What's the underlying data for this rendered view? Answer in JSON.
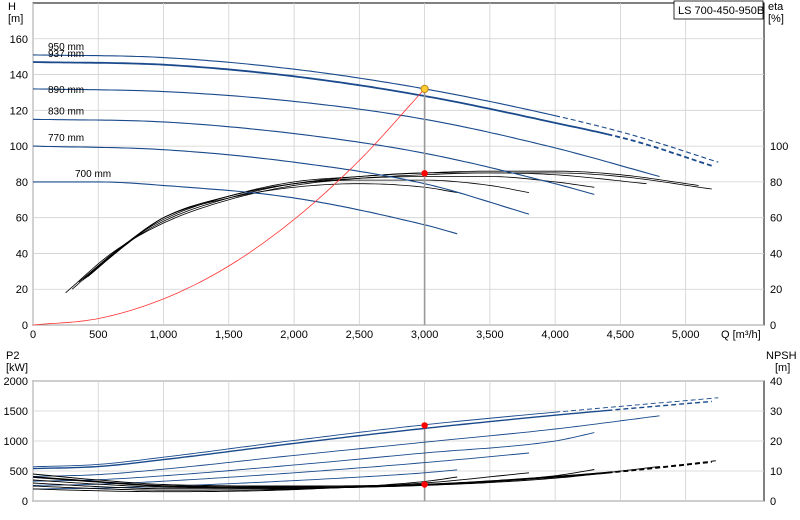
{
  "model": "LS 700-450-950B",
  "chart_data": [
    {
      "type": "line",
      "name": "head-efficiency",
      "xlabel": "Q [m³/h]",
      "ylabel_left": [
        "H",
        "[m]"
      ],
      "ylabel_right": [
        "eta",
        "[%]"
      ],
      "xlim": [
        0,
        5600
      ],
      "ylim_left": [
        0,
        180
      ],
      "ylim_right": [
        0,
        180
      ],
      "x_ticks": [
        "0",
        "500",
        "1,000",
        "1,500",
        "2,000",
        "2,500",
        "3,000",
        "3,500",
        "4,000",
        "4,500",
        "5,000"
      ],
      "x_tick_values": [
        0,
        500,
        1000,
        1500,
        2000,
        2500,
        3000,
        3500,
        4000,
        4500,
        5000
      ],
      "y_ticks_left": [
        "0",
        "20",
        "40",
        "60",
        "80",
        "100",
        "120",
        "140",
        "160"
      ],
      "y_tick_values_left": [
        0,
        20,
        40,
        60,
        80,
        100,
        120,
        140,
        160
      ],
      "y_ticks_right": [
        "0",
        "20",
        "40",
        "60",
        "80",
        "100"
      ],
      "y_tick_values_right": [
        0,
        20,
        40,
        60,
        80,
        100
      ],
      "grid": true,
      "head_curves": [
        {
          "label": "950 mm",
          "x": [
            0,
            1000,
            2000,
            3000,
            4000,
            4600,
            5250
          ],
          "y": [
            151,
            149.5,
            143,
            132,
            117,
            106,
            91
          ],
          "solid_until": 4000
        },
        {
          "label": "937 mm",
          "x": [
            0,
            1000,
            2000,
            3000,
            4000,
            4600,
            5200
          ],
          "y": [
            147,
            145.5,
            139,
            128,
            113,
            103,
            89
          ],
          "solid_until": 4400
        },
        {
          "label": "890 mm",
          "x": [
            0,
            1000,
            2000,
            3000,
            4000,
            4800
          ],
          "y": [
            132,
            130.5,
            125,
            115,
            99,
            83
          ],
          "solid_until": 4800
        },
        {
          "label": "830 mm",
          "x": [
            0,
            1000,
            2000,
            3000,
            4000,
            4300
          ],
          "y": [
            115,
            113.5,
            107,
            96,
            79,
            73
          ],
          "solid_until": 4300
        },
        {
          "label": "770 mm",
          "x": [
            0,
            1000,
            2000,
            3000,
            3800
          ],
          "y": [
            100,
            98,
            91,
            79,
            62
          ],
          "solid_until": 3800
        },
        {
          "label": "700 mm",
          "x": [
            0,
            500,
            1000,
            2000,
            3000,
            3250
          ],
          "y": [
            80,
            80,
            78,
            71,
            56,
            51
          ],
          "solid_until": 3250
        }
      ],
      "efficiency_curves": [
        {
          "x": [
            250,
            600,
            1000,
            1500,
            2000,
            2500,
            3000,
            3500,
            4000,
            4500,
            5200
          ],
          "y": [
            18,
            40,
            57,
            70,
            78,
            82,
            84,
            85,
            85,
            83,
            76
          ]
        },
        {
          "x": [
            300,
            650,
            1000,
            1500,
            2000,
            2500,
            3000,
            3500,
            4000,
            4500,
            5100
          ],
          "y": [
            20,
            42,
            58,
            71,
            79,
            83,
            85,
            86,
            86,
            84,
            78
          ]
        },
        {
          "x": [
            350,
            700,
            1000,
            1500,
            2000,
            2500,
            3000,
            3500,
            4000,
            4700
          ],
          "y": [
            24,
            45,
            59,
            72,
            80,
            83,
            85,
            85,
            84,
            79
          ]
        },
        {
          "x": [
            380,
            720,
            1000,
            1500,
            2000,
            2500,
            3000,
            3500,
            4000,
            4300
          ],
          "y": [
            25,
            46,
            60,
            72,
            79,
            82,
            83,
            83,
            80,
            77
          ]
        },
        {
          "x": [
            400,
            750,
            1000,
            1500,
            2000,
            2500,
            3000,
            3500,
            3800
          ],
          "y": [
            26,
            47,
            60,
            72,
            79,
            81,
            81,
            78,
            74
          ]
        },
        {
          "x": [
            420,
            760,
            1000,
            1500,
            2000,
            2500,
            3000,
            3250
          ],
          "y": [
            27,
            48,
            60,
            71,
            77,
            79,
            77,
            74
          ]
        }
      ],
      "system_curve": {
        "x": [
          0,
          500,
          1000,
          1500,
          2000,
          2500,
          3000
        ],
        "y": [
          0,
          3.6,
          14.6,
          33,
          59,
          92,
          132
        ]
      },
      "duty_point": {
        "x": 3000,
        "y_head": 132,
        "y_eta": 84.8
      }
    },
    {
      "type": "line",
      "name": "power-npsh",
      "ylabel_left": [
        "P2",
        "[kW]"
      ],
      "ylabel_right": [
        "NPSH",
        "[m]"
      ],
      "xlim": [
        0,
        5600
      ],
      "ylim_left": [
        0,
        2000
      ],
      "ylim_right": [
        0,
        40
      ],
      "y_ticks_left": [
        "0",
        "500",
        "1000",
        "1500",
        "2000"
      ],
      "y_tick_values_left": [
        0,
        500,
        1000,
        1500,
        2000
      ],
      "y_ticks_right": [
        "0",
        "10",
        "20",
        "30",
        "40"
      ],
      "y_tick_values_right": [
        0,
        10,
        20,
        30,
        40
      ],
      "grid": true,
      "power_curves": [
        {
          "x": [
            0,
            500,
            1000,
            2000,
            3000,
            4000,
            5250
          ],
          "y": [
            570,
            610,
            730,
            1010,
            1270,
            1480,
            1720
          ],
          "solid_until": 4000
        },
        {
          "x": [
            0,
            500,
            1000,
            2000,
            3000,
            4000,
            5200
          ],
          "y": [
            540,
            575,
            690,
            960,
            1210,
            1430,
            1660
          ],
          "solid_until": 4400
        },
        {
          "x": [
            0,
            500,
            1000,
            2000,
            3000,
            4000,
            4800
          ],
          "y": [
            410,
            440,
            530,
            760,
            980,
            1200,
            1420
          ],
          "solid_until": 4800
        },
        {
          "x": [
            0,
            500,
            1000,
            2000,
            3000,
            4000,
            4300
          ],
          "y": [
            330,
            355,
            420,
            600,
            800,
            1000,
            1140
          ],
          "solid_until": 4300
        },
        {
          "x": [
            0,
            500,
            1000,
            2000,
            3000,
            3800
          ],
          "y": [
            260,
            280,
            330,
            470,
            640,
            800
          ],
          "solid_until": 3800
        },
        {
          "x": [
            0,
            500,
            1000,
            2000,
            3000,
            3250
          ],
          "y": [
            200,
            215,
            245,
            340,
            470,
            520
          ],
          "solid_until": 3250
        }
      ],
      "npsh_curves": [
        {
          "x": [
            0,
            500,
            1000,
            2000,
            3000,
            4000,
            4500,
            5250
          ],
          "y": [
            9,
            7,
            5.5,
            5,
            5.6,
            8.2,
            10,
            13.5
          ],
          "solid_until": 4400
        },
        {
          "x": [
            0,
            500,
            1000,
            2000,
            3000,
            4000,
            4500,
            5200
          ],
          "y": [
            8,
            6.4,
            5,
            4.6,
            5.4,
            8,
            9.8,
            13
          ],
          "solid_until": 4400
        },
        {
          "x": [
            0,
            500,
            1000,
            2000,
            3000,
            4000,
            4800
          ],
          "y": [
            7,
            5.6,
            4.6,
            4.4,
            5.2,
            7.6,
            11.5
          ],
          "solid_until": 4800
        },
        {
          "x": [
            0,
            500,
            1000,
            2000,
            3000,
            4000,
            4300
          ],
          "y": [
            6,
            4.8,
            4.1,
            4.2,
            5.4,
            8.4,
            10.5
          ],
          "solid_until": 4300
        },
        {
          "x": [
            0,
            500,
            1000,
            2000,
            3000,
            3800
          ],
          "y": [
            5,
            4.1,
            3.6,
            4,
            6,
            9.4
          ],
          "solid_until": 3800
        },
        {
          "x": [
            0,
            500,
            1000,
            2000,
            3000,
            3250
          ],
          "y": [
            4,
            3.4,
            3.1,
            3.8,
            6.5,
            8
          ],
          "solid_until": 3250
        }
      ],
      "duty_point": {
        "x": 3000,
        "y_power": 1260,
        "y_npsh": 5.5
      }
    }
  ],
  "colors": {
    "head": "#1a4a8c",
    "efficiency": "#000000",
    "system": "#ff3333",
    "grid": "#d0d0d0",
    "duty_marker": "#ff0000",
    "duty_head_marker": "#ffcc33",
    "duty_line": "#999999"
  }
}
